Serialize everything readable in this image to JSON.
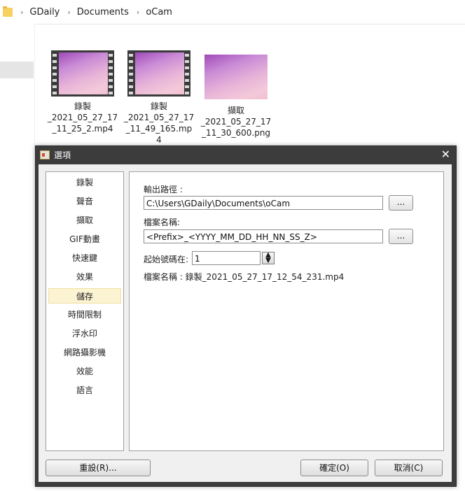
{
  "explorer": {
    "breadcrumb": [
      "GDaily",
      "Documents",
      "oCam"
    ],
    "files": [
      {
        "name": "錄製\n_2021_05_27_17\n_11_25_2.mp4",
        "kind": "video"
      },
      {
        "name": "錄製\n_2021_05_27_17\n_11_49_165.mp\n4",
        "kind": "video"
      },
      {
        "name": "擷取\n_2021_05_27_17\n_11_30_600.png",
        "kind": "image"
      }
    ]
  },
  "dialog": {
    "title": "選項",
    "close_symbol": "✕",
    "categories": [
      "錄製",
      "聲音",
      "擷取",
      "GIF動畫",
      "快速鍵",
      "效果",
      "儲存",
      "時間限制",
      "浮水印",
      "網路攝影機",
      "效能",
      "語言"
    ],
    "selected_category": "儲存",
    "output_path_label": "輸出路徑 :",
    "output_path_value": "C:\\Users\\GDaily\\Documents\\oCam",
    "file_name_label": "檔案名稱:",
    "file_name_value": "<Prefix>_<YYYY_MM_DD_HH_NN_SS_Z>",
    "browse_label": "...",
    "start_number_label": "起始號碼在:",
    "start_number_value": "1",
    "preview_text": "檔案名稱 : 錄製_2021_05_27_17_12_54_231.mp4",
    "reset_button": "重設(R)...",
    "ok_button": "確定(O)",
    "cancel_button": "取消(C)"
  },
  "colors": {
    "dialog_frame": "#3c3c3c",
    "selected_category_bg": "#fcf3d2",
    "thumbnail_tint": "#c98bd6"
  },
  "icons": [
    "folder-icon",
    "chevron-right-icon",
    "film-icon",
    "app-icon",
    "close-icon",
    "spinner-icon"
  ]
}
